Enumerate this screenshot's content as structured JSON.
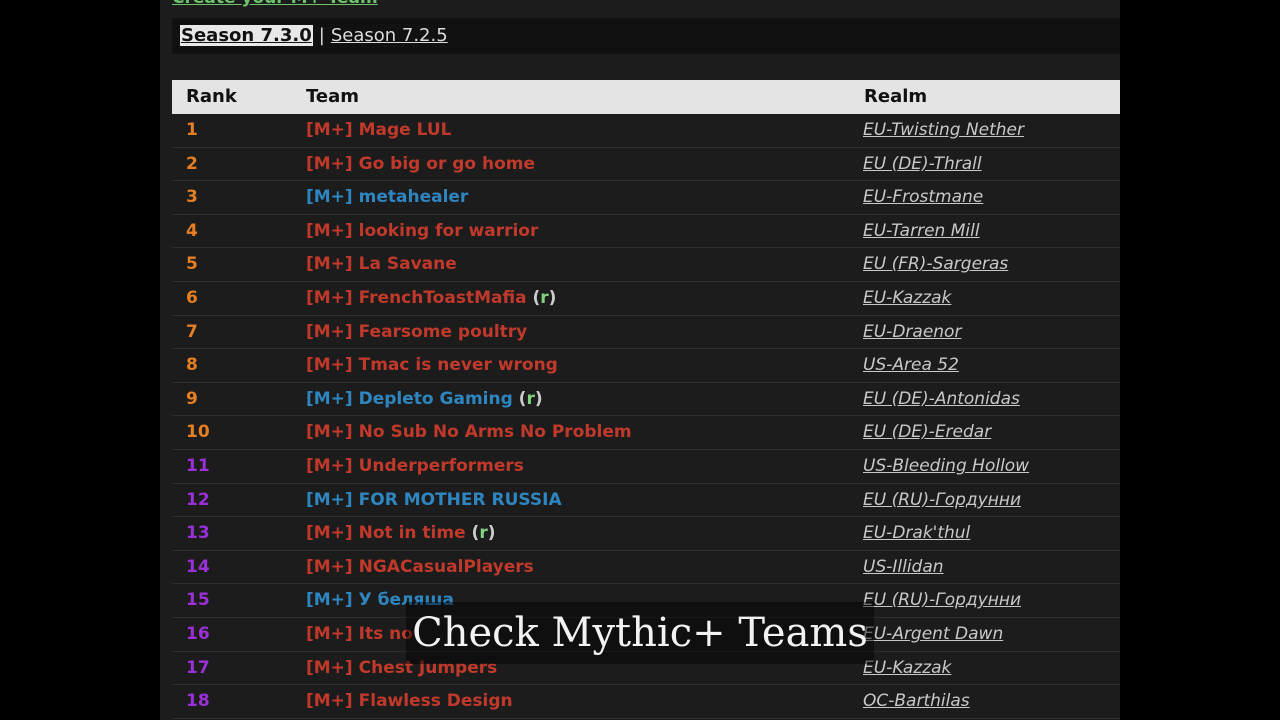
{
  "header": {
    "create_link": "Create your M+ Team"
  },
  "seasons": {
    "active": "Season 7.3.0",
    "separator": "|",
    "other": "Season 7.2.5"
  },
  "table": {
    "columns": [
      "Rank",
      "Team",
      "Realm"
    ],
    "rows": [
      {
        "rank": "1",
        "prefix": "[M+]",
        "name": "Mage LUL",
        "r": "",
        "realm": "EU-Twisting Nether",
        "rank_color": "#e67e22",
        "team_color": "#c0392b"
      },
      {
        "rank": "2",
        "prefix": "[M+]",
        "name": "Go big or go home",
        "r": "",
        "realm": "EU (DE)-Thrall",
        "rank_color": "#e67e22",
        "team_color": "#c0392b"
      },
      {
        "rank": "3",
        "prefix": "[M+]",
        "name": "metahealer",
        "r": "",
        "realm": "EU-Frostmane",
        "rank_color": "#e67e22",
        "team_color": "#2e86c1"
      },
      {
        "rank": "4",
        "prefix": "[M+]",
        "name": "looking for warrior",
        "r": "",
        "realm": "EU-Tarren Mill",
        "rank_color": "#e67e22",
        "team_color": "#c0392b"
      },
      {
        "rank": "5",
        "prefix": "[M+]",
        "name": "La Savane",
        "r": "",
        "realm": "EU (FR)-Sargeras",
        "rank_color": "#e67e22",
        "team_color": "#c0392b"
      },
      {
        "rank": "6",
        "prefix": "[M+]",
        "name": "FrenchToastMafia",
        "r": "r",
        "realm": "EU-Kazzak",
        "rank_color": "#e67e22",
        "team_color": "#c0392b"
      },
      {
        "rank": "7",
        "prefix": "[M+]",
        "name": "Fearsome poultry",
        "r": "",
        "realm": "EU-Draenor",
        "rank_color": "#e67e22",
        "team_color": "#c0392b"
      },
      {
        "rank": "8",
        "prefix": "[M+]",
        "name": "Tmac is never wrong",
        "r": "",
        "realm": "US-Area 52",
        "rank_color": "#e67e22",
        "team_color": "#c0392b"
      },
      {
        "rank": "9",
        "prefix": "[M+]",
        "name": "Depleto Gaming",
        "r": "r",
        "realm": "EU (DE)-Antonidas",
        "rank_color": "#e67e22",
        "team_color": "#2e86c1"
      },
      {
        "rank": "10",
        "prefix": "[M+]",
        "name": "No Sub No Arms No Problem",
        "r": "",
        "realm": "EU (DE)-Eredar",
        "rank_color": "#e67e22",
        "team_color": "#c0392b"
      },
      {
        "rank": "11",
        "prefix": "[M+]",
        "name": "Underperformers",
        "r": "",
        "realm": "US-Bleeding Hollow",
        "rank_color": "#9b30d9",
        "team_color": "#c0392b"
      },
      {
        "rank": "12",
        "prefix": "[M+]",
        "name": "FOR MOTHER RUSSIA",
        "r": "",
        "realm": "EU (RU)-Гордунни",
        "rank_color": "#9b30d9",
        "team_color": "#2e86c1"
      },
      {
        "rank": "13",
        "prefix": "[M+]",
        "name": "Not in time",
        "r": "r",
        "realm": "EU-Drak'thul",
        "rank_color": "#9b30d9",
        "team_color": "#c0392b"
      },
      {
        "rank": "14",
        "prefix": "[M+]",
        "name": "NGACasualPlayers",
        "r": "",
        "realm": "US-Illidan",
        "rank_color": "#9b30d9",
        "team_color": "#c0392b"
      },
      {
        "rank": "15",
        "prefix": "[M+]",
        "name": "У беляша",
        "r": "",
        "realm": "EU (RU)-Гордунни",
        "rank_color": "#9b30d9",
        "team_color": "#2e86c1"
      },
      {
        "rank": "16",
        "prefix": "[M+]",
        "name": "Its no",
        "r": "",
        "realm": "EU-Argent Dawn",
        "rank_color": "#9b30d9",
        "team_color": "#c0392b"
      },
      {
        "rank": "17",
        "prefix": "[M+]",
        "name": "Chest Jumpers",
        "r": "",
        "realm": "EU-Kazzak",
        "rank_color": "#9b30d9",
        "team_color": "#c0392b"
      },
      {
        "rank": "18",
        "prefix": "[M+]",
        "name": "Flawless Design",
        "r": "",
        "realm": "OC-Barthilas",
        "rank_color": "#9b30d9",
        "team_color": "#c0392b"
      }
    ]
  },
  "caption": "Check Mythic+ Teams"
}
